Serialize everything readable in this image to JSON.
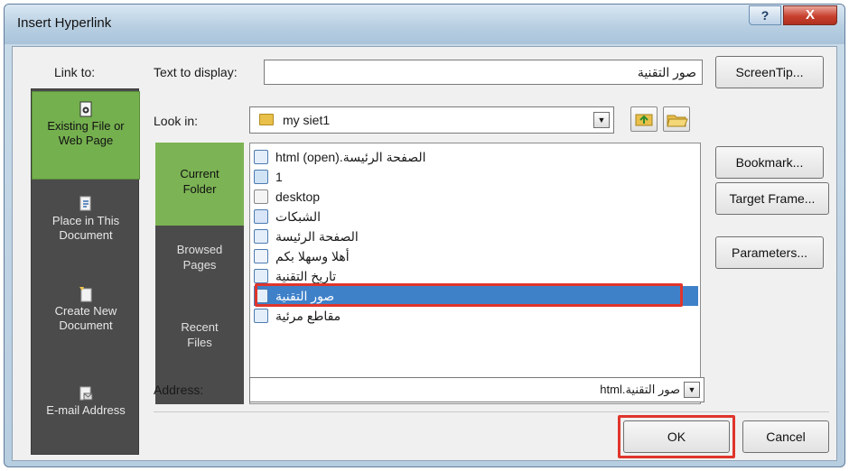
{
  "window": {
    "title": "Insert Hyperlink",
    "help_label": "?",
    "close_label": "X"
  },
  "link_to": {
    "label": "Link to:",
    "items": [
      {
        "label_line1": "Existing File or",
        "label_line2": "Web Page",
        "icon": "existing-file-icon",
        "active": true
      },
      {
        "label_line1": "Place in This",
        "label_line2": "Document",
        "icon": "place-in-document-icon",
        "active": false
      },
      {
        "label_line1": "Create New",
        "label_line2": "Document",
        "icon": "new-document-icon",
        "active": false
      },
      {
        "label_line1": "E-mail Address",
        "label_line2": "",
        "icon": "email-icon",
        "active": false
      }
    ]
  },
  "text_to_display": {
    "label": "Text to display:",
    "value": "صور التقنية"
  },
  "look_in": {
    "label": "Look in:",
    "value": "my siet1",
    "folder_icon": "folder-icon",
    "up_folder_icon": "up-folder-icon",
    "browse_icon": "open-folder-icon"
  },
  "places": [
    {
      "line1": "Current",
      "line2": "Folder",
      "active": true
    },
    {
      "line1": "Browsed",
      "line2": "Pages",
      "active": false
    },
    {
      "line1": "Recent",
      "line2": "Files",
      "active": false
    }
  ],
  "files": [
    {
      "name": "الصفحة الرئيسة.html (open)",
      "icon": "html-file-icon"
    },
    {
      "name": "1",
      "icon": "image-file-icon"
    },
    {
      "name": "desktop",
      "icon": "settings-file-icon"
    },
    {
      "name": "الشبكات",
      "icon": "word-file-icon"
    },
    {
      "name": "الصفحة الرئيسة",
      "icon": "html-file-icon"
    },
    {
      "name": "أهلا وسهلا بكم",
      "icon": "audio-file-icon"
    },
    {
      "name": "تاريخ التقنية",
      "icon": "html-file-icon"
    },
    {
      "name": "صور التقنية",
      "icon": "html-file-icon",
      "selected": true
    },
    {
      "name": "مقاطع مرئية",
      "icon": "html-file-icon"
    }
  ],
  "address": {
    "label": "Address:",
    "value": "صور التقنية.html"
  },
  "buttons": {
    "screentip": "ScreenTip...",
    "bookmark": "Bookmark...",
    "target_frame": "Target Frame...",
    "parameters": "Parameters...",
    "ok": "OK",
    "cancel": "Cancel"
  },
  "colors": {
    "active_green": "#75b04f",
    "sidebar_dark": "#4b4b4b",
    "selection_blue": "#3f81c9",
    "highlight_red": "#e0352b"
  }
}
